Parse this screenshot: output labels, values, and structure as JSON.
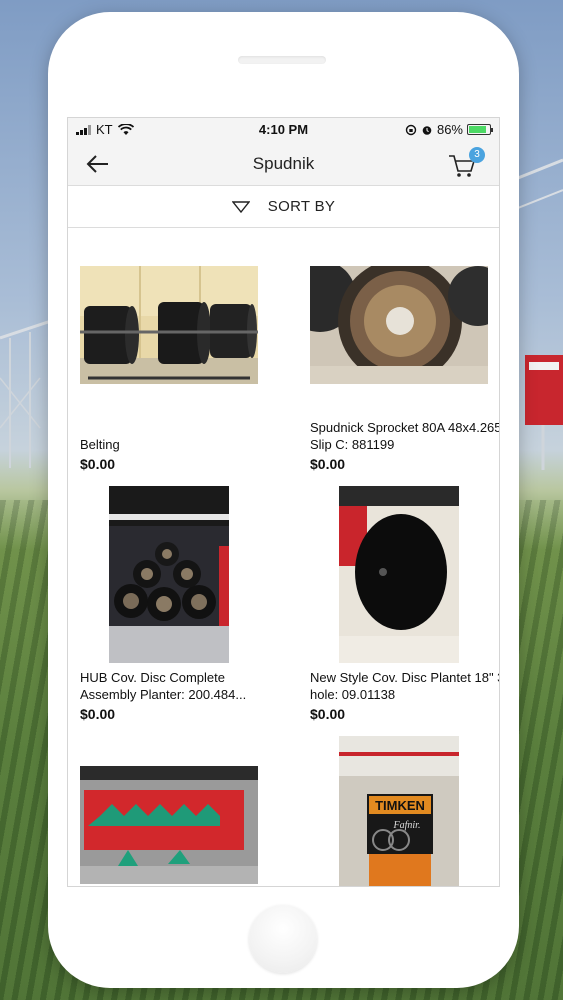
{
  "status_bar": {
    "carrier": "KT",
    "time": "4:10 PM",
    "battery": "86%",
    "battery_level": 0.86
  },
  "nav": {
    "title": "Spudnik",
    "back_icon": "back-arrow-icon",
    "cart_icon": "cart-icon",
    "cart_count": "3"
  },
  "sort": {
    "label": "SORT BY",
    "icon": "triangle-down-icon"
  },
  "products": [
    {
      "name": "Belting",
      "price": "$0.00",
      "image": "black-belting-rollers"
    },
    {
      "name": "Spudnick Sprocket 80A 48x4.265 Slip C: 881199",
      "price": "$0.00",
      "image": "sprocket-wheel"
    },
    {
      "name": "HUB Cov. Disc Complete Assembly Planter: 200.484...",
      "price": "$0.00",
      "image": "hub-assemblies"
    },
    {
      "name": "New Style Cov. Disc Plantet 18\" 3 hole: 09.01138",
      "price": "$0.00",
      "image": "black-disc"
    },
    {
      "name": "",
      "price": "",
      "image": "green-parts-in-red-bin"
    },
    {
      "name": "",
      "price": "",
      "image": "timken-bearing-box"
    }
  ],
  "timken_box": {
    "brand": "TIMKEN",
    "sub": "Fafnir."
  }
}
